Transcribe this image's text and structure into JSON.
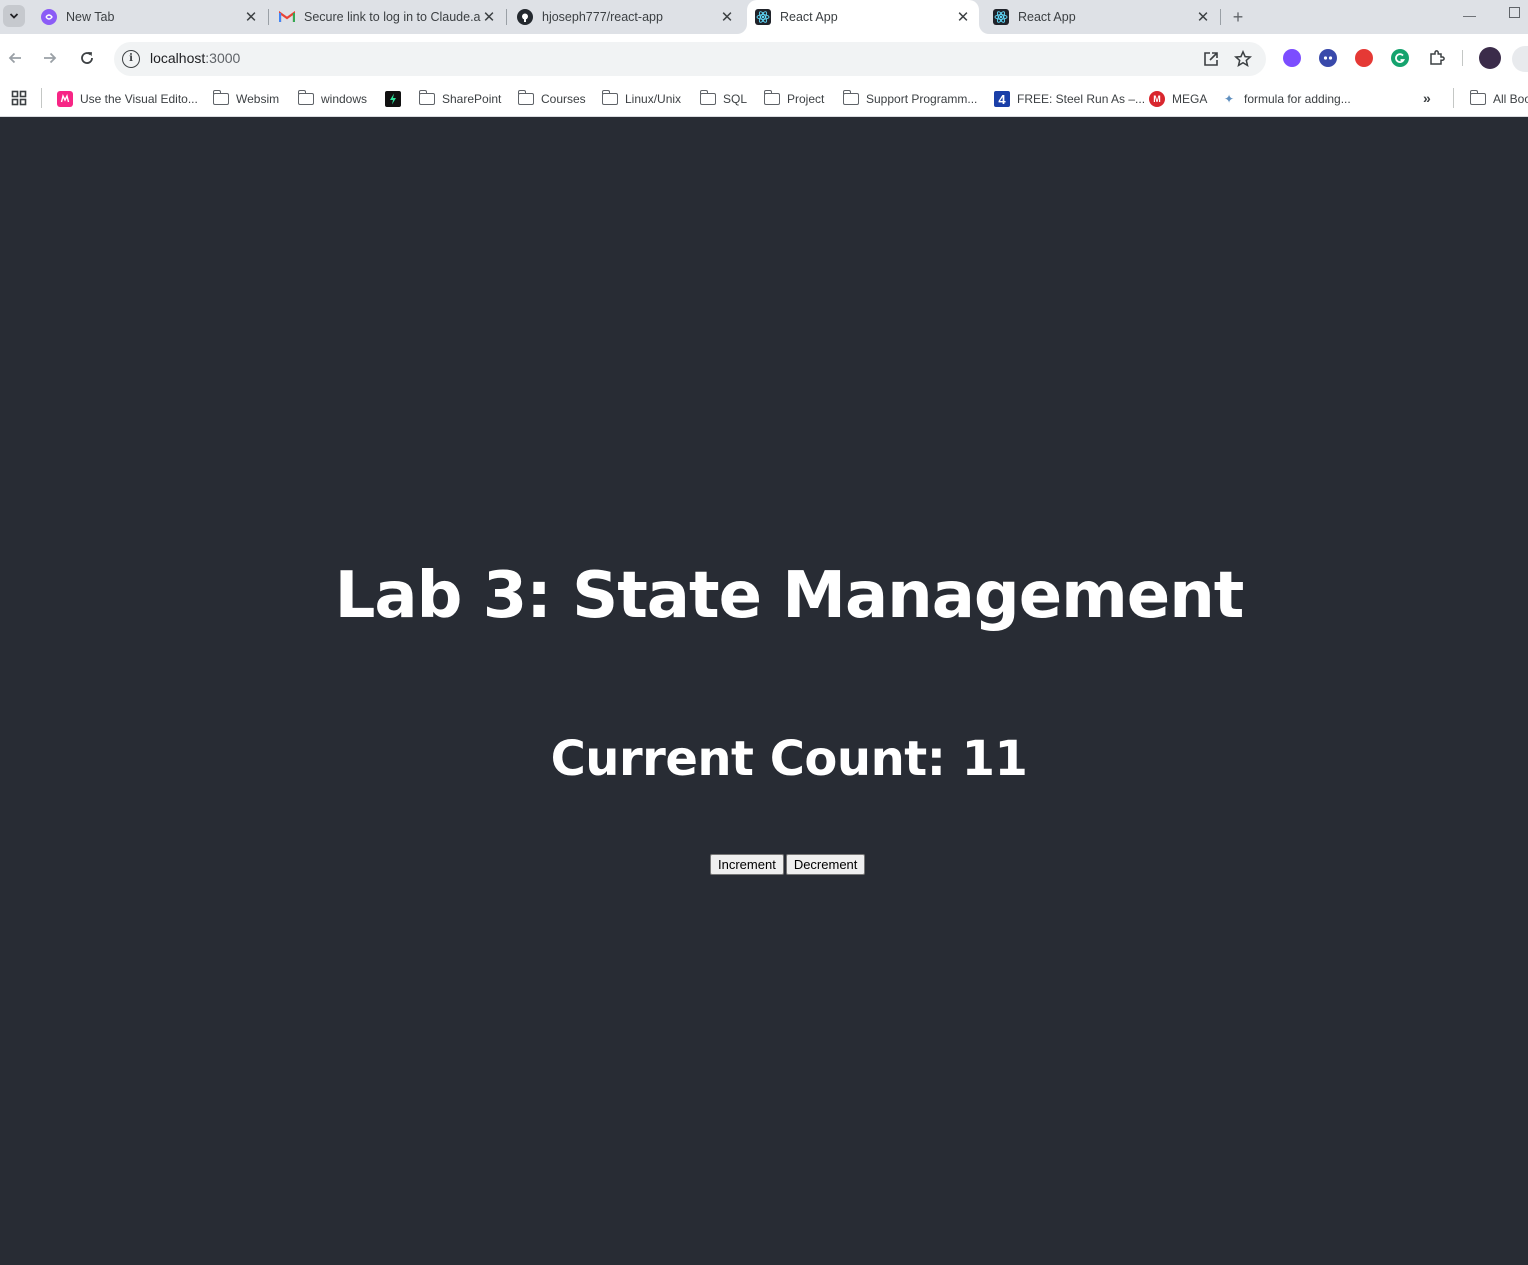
{
  "tabs": [
    {
      "title": "New Tab",
      "icon": "new-tab-icon",
      "active": false
    },
    {
      "title": "Secure link to log in to Claude.ai",
      "icon": "gmail-icon",
      "active": false
    },
    {
      "title": "hjoseph777/react-app",
      "icon": "github-icon",
      "active": false
    },
    {
      "title": "React App",
      "icon": "react-icon",
      "active": true
    },
    {
      "title": "React App",
      "icon": "react-icon",
      "active": false
    }
  ],
  "address_bar": {
    "host": "localhost",
    "port": ":3000"
  },
  "bookmarks": [
    {
      "label": "Use the Visual Edito...",
      "icon": "miro-icon"
    },
    {
      "label": "Websim",
      "icon": "folder-icon"
    },
    {
      "label": "windows",
      "icon": "folder-icon"
    },
    {
      "label": "",
      "icon": "bolt-icon"
    },
    {
      "label": "SharePoint",
      "icon": "folder-icon"
    },
    {
      "label": "Courses",
      "icon": "folder-icon"
    },
    {
      "label": "Linux/Unix",
      "icon": "folder-icon"
    },
    {
      "label": "SQL",
      "icon": "folder-icon"
    },
    {
      "label": "Project",
      "icon": "folder-icon"
    },
    {
      "label": "Support Programm...",
      "icon": "folder-icon"
    },
    {
      "label": "FREE: Steel Run As –...",
      "icon": "four-icon"
    },
    {
      "label": "MEGA",
      "icon": "mega-icon"
    },
    {
      "label": "formula for adding...",
      "icon": "sparkle-icon"
    },
    {
      "label": "All Boo",
      "icon": "folder-icon"
    }
  ],
  "page": {
    "title": "Lab 3: State Management",
    "count_label": "Current Count: ",
    "count_value": "11",
    "increment_label": "Increment",
    "decrement_label": "Decrement"
  },
  "colors": {
    "page_background": "#282c34",
    "tab_strip": "#dee1e6",
    "text_on_page": "#ffffff"
  }
}
